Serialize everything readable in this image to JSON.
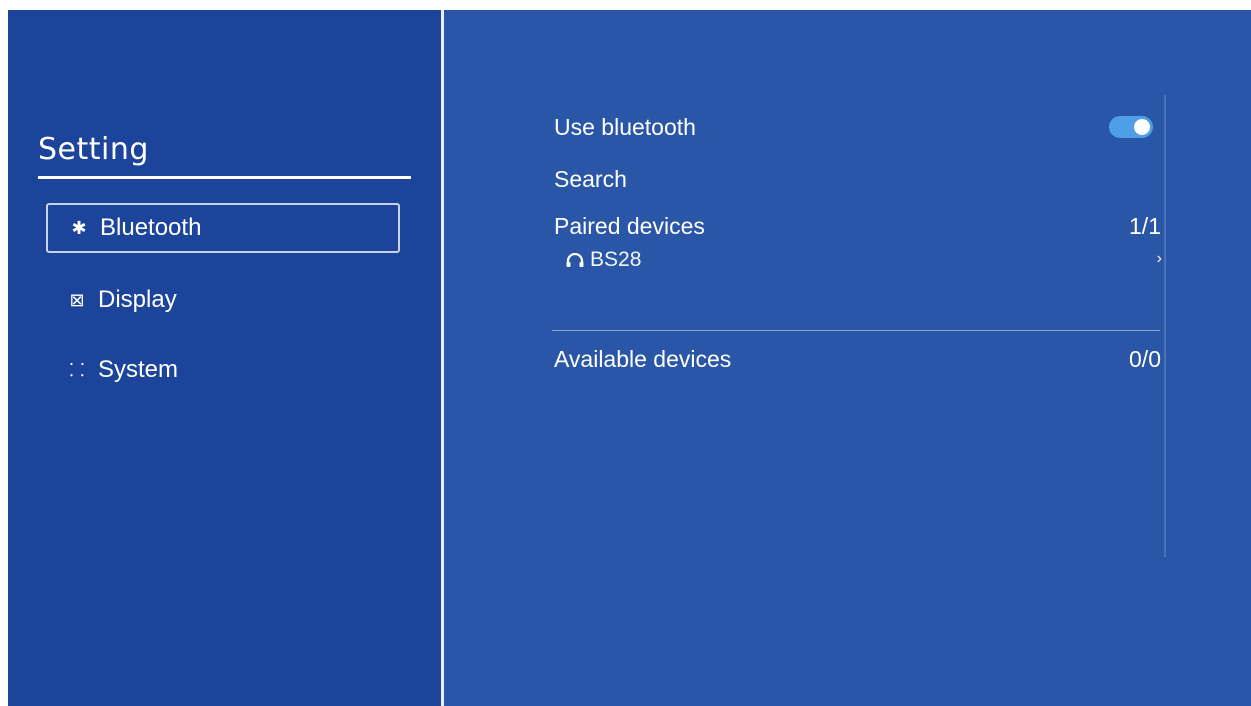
{
  "sidebar": {
    "title": "Setting",
    "items": [
      {
        "label": "Bluetooth",
        "icon": "bluetooth-icon",
        "glyph": "✱",
        "selected": true
      },
      {
        "label": "Display",
        "icon": "image-icon",
        "glyph": "⊠",
        "selected": false
      },
      {
        "label": "System",
        "icon": "apps-grid-icon",
        "glyph": "⸬",
        "selected": false
      }
    ]
  },
  "bluetooth": {
    "use_label": "Use bluetooth",
    "use_enabled": true,
    "search_label": "Search",
    "paired_label": "Paired devices",
    "paired_count": "1/1",
    "paired_devices": [
      {
        "name": "BS28",
        "icon": "headphones-icon"
      }
    ],
    "available_label": "Available devices",
    "available_count": "0/0"
  },
  "colors": {
    "sidebar_bg": "#1c449a",
    "main_bg": "#2956a7",
    "toggle_on": "#4f9fe6"
  }
}
